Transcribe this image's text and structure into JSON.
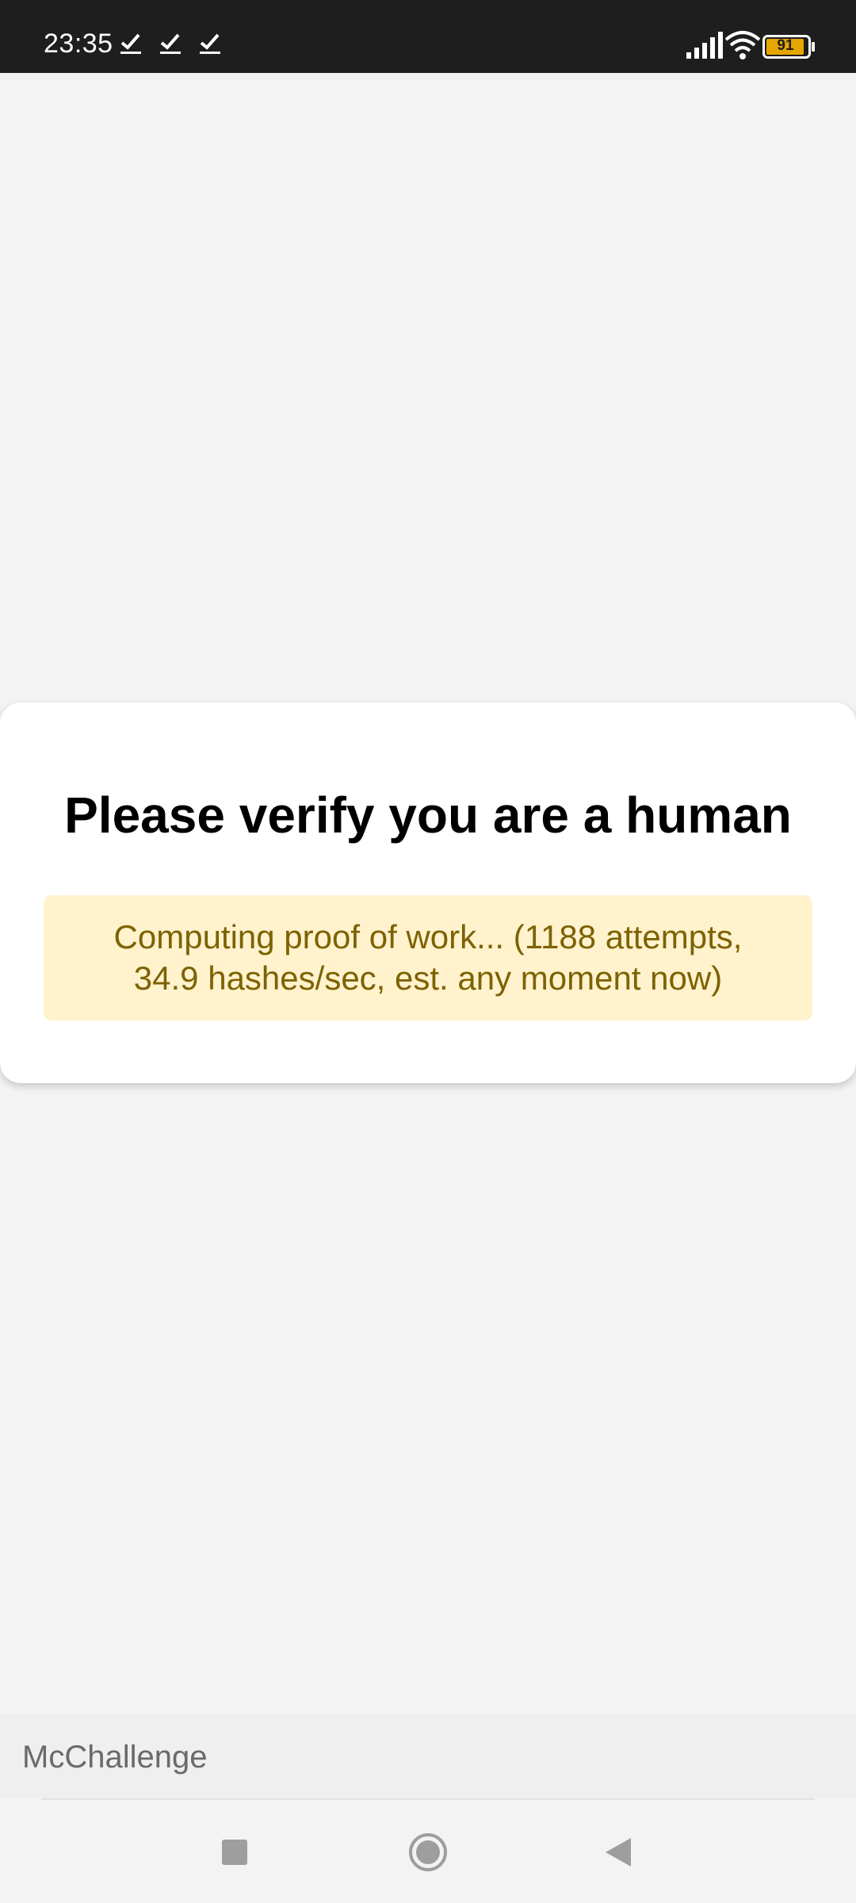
{
  "status_bar": {
    "time": "23:35",
    "notification_icons": [
      "check-icon",
      "check-icon",
      "check-icon"
    ],
    "battery_level": "91",
    "icons": [
      "signal-icon",
      "wifi-icon",
      "battery-icon"
    ]
  },
  "dialog": {
    "title": "Please verify you are a human",
    "status_line_1": "Computing proof of work... (1188 attempts,",
    "status_line_2": "34.9 hashes/sec, est. any moment now)"
  },
  "footer": {
    "app_label": "McChallenge"
  },
  "navigation": {
    "buttons": [
      "recents-button",
      "home-button",
      "back-button"
    ]
  },
  "colors": {
    "status_bar_bg": "#1e1e1e",
    "page_bg": "#f3f3f3",
    "status_box_bg": "#fff2cd",
    "status_box_text": "#7d6200",
    "battery_fill": "#e6a600"
  }
}
